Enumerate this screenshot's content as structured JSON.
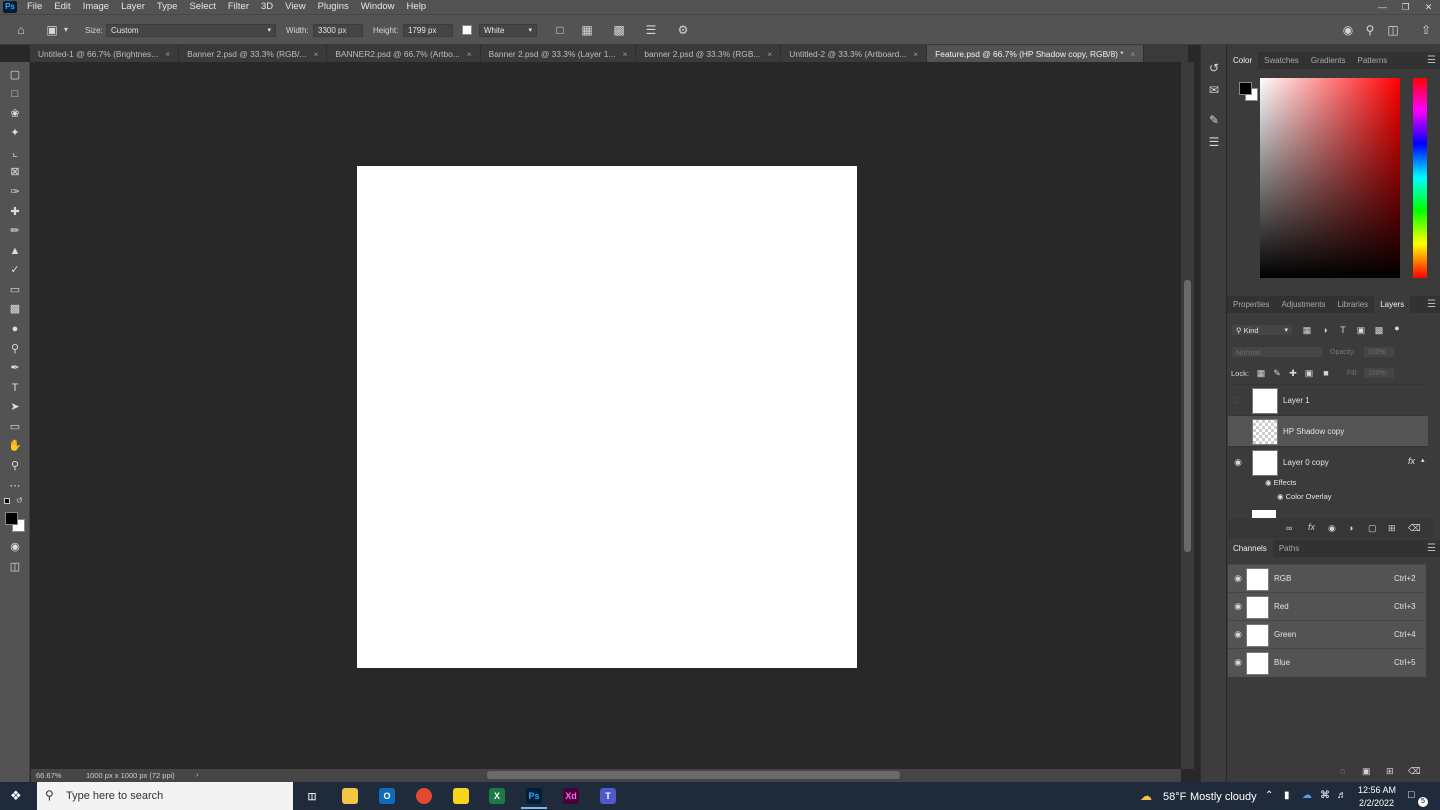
{
  "app": {
    "logo": "Ps",
    "menu": [
      "File",
      "Edit",
      "Image",
      "Layer",
      "Type",
      "Select",
      "Filter",
      "3D",
      "View",
      "Plugins",
      "Window",
      "Help"
    ]
  },
  "options_bar": {
    "size_label": "Size:",
    "size_value": "Custom",
    "width_label": "Width:",
    "width_value": "3300 px",
    "height_label": "Height:",
    "height_value": "1799 px",
    "fill_value": "White"
  },
  "tabs": [
    {
      "label": "Untitled-1 @ 66.7% (Brightnes...",
      "active": false
    },
    {
      "label": "Banner 2.psd @ 33.3% (RGB/...",
      "active": false
    },
    {
      "label": "BANNER2.psd @ 66.7% (Artbo...",
      "active": false
    },
    {
      "label": "Banner 2.psd @ 33.3% (Layer 1...",
      "active": false
    },
    {
      "label": "banner 2.psd @ 33.3% (RGB...",
      "active": false
    },
    {
      "label": "Untitled-2 @ 33.3% (Artboard...",
      "active": false
    },
    {
      "label": "Feature.psd @ 66.7% (HP Shadow copy, RGB/8) *",
      "active": true
    }
  ],
  "status_bar": {
    "zoom": "66.67%",
    "doc_info": "1000 px x 1000 px (72 ppi)"
  },
  "color_panel": {
    "tabs": [
      "Color",
      "Swatches",
      "Gradients",
      "Patterns"
    ],
    "active_tab": "Color",
    "foreground": "#000000",
    "background": "#ffffff"
  },
  "layers_panel": {
    "tabs": [
      "Properties",
      "Adjustments",
      "Libraries",
      "Layers"
    ],
    "active_tab": "Layers",
    "filter_kind": "Kind",
    "blend_mode": "Normal",
    "opacity_label": "Opacity:",
    "opacity_value": "100%",
    "lock_label": "Lock:",
    "fill_label": "Fill:",
    "fill_value": "100%",
    "layers": [
      {
        "name": "Layer 1",
        "visible": false,
        "selected": false
      },
      {
        "name": "HP Shadow copy",
        "visible": false,
        "selected": true
      },
      {
        "name": "Layer 0 copy",
        "visible": true,
        "selected": false,
        "fx": "fx"
      }
    ],
    "effects_label": "Effects",
    "effect_item": "Color Overlay"
  },
  "channels_panel": {
    "tabs": [
      "Channels",
      "Paths"
    ],
    "active_tab": "Channels",
    "channels": [
      {
        "name": "RGB",
        "shortcut": "Ctrl+2"
      },
      {
        "name": "Red",
        "shortcut": "Ctrl+3"
      },
      {
        "name": "Green",
        "shortcut": "Ctrl+4"
      },
      {
        "name": "Blue",
        "shortcut": "Ctrl+5"
      }
    ]
  },
  "taskbar": {
    "search_placeholder": "Type here to search",
    "weather_temp": "58°F",
    "weather_desc": "Mostly cloudy",
    "time": "12:56 AM",
    "date": "2/2/2022",
    "notification_count": "5",
    "apps": [
      {
        "icon": "task-view-icon",
        "label": "",
        "color": "#1f2a3a"
      },
      {
        "icon": "file-explorer-icon",
        "label": "",
        "color": "#f4c542"
      },
      {
        "icon": "outlook-icon",
        "label": "O",
        "color": "#0f6cbd"
      },
      {
        "icon": "chrome-icon",
        "label": "",
        "color": "#e24a33"
      },
      {
        "icon": "sticky-notes-icon",
        "label": "",
        "color": "#f7d51d"
      },
      {
        "icon": "excel-icon",
        "label": "X",
        "color": "#1d7a45"
      },
      {
        "icon": "photoshop-icon",
        "label": "Ps",
        "color": "#001e36"
      },
      {
        "icon": "adobe-xd-icon",
        "label": "Xd",
        "color": "#470137"
      },
      {
        "icon": "teams-icon",
        "label": "T",
        "color": "#5059c9"
      }
    ]
  }
}
